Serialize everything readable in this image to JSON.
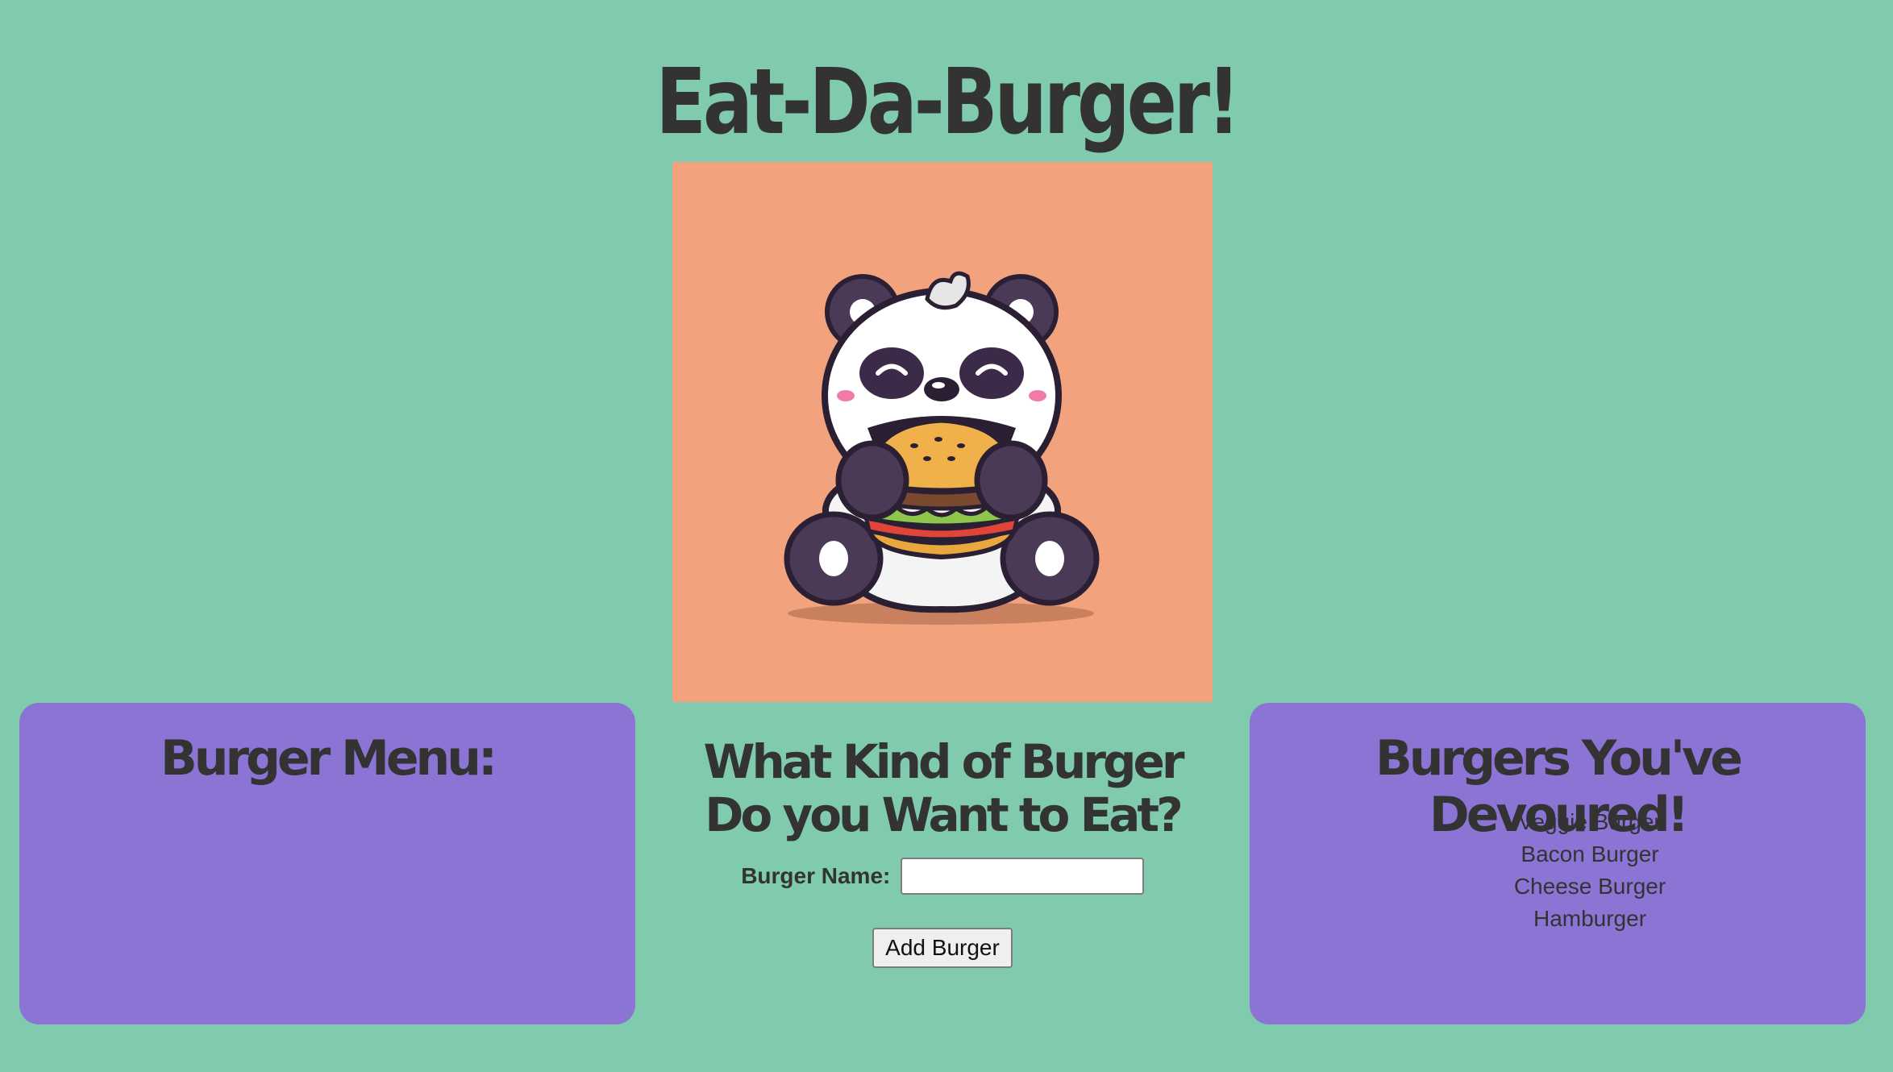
{
  "header": {
    "title": "Eat-Da-Burger!"
  },
  "hero": {
    "image": "panda-eating-burger-illustration",
    "background_color": "#f2a37e"
  },
  "menu_panel": {
    "heading": "Burger Menu:",
    "items": []
  },
  "order_form": {
    "heading": "What Kind of Burger Do you Want to Eat?",
    "name_label": "Burger Name:",
    "name_value": "",
    "name_placeholder": "",
    "submit_label": "Add Burger"
  },
  "devoured_panel": {
    "heading": "Burgers You've Devoured!",
    "items": [
      "Veggie Burger",
      "Bacon Burger",
      "Cheese Burger",
      "Hamburger"
    ]
  },
  "colors": {
    "page_background": "#80cbad",
    "panel_background": "#8b74d4",
    "text": "#333333"
  }
}
